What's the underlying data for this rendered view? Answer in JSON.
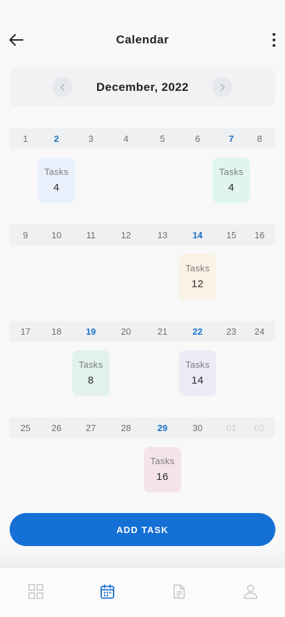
{
  "header": {
    "title": "Calendar",
    "back_icon": "arrow-left-icon",
    "more_icon": "more-vertical-icon"
  },
  "month_nav": {
    "label": "December, 2022",
    "prev_icon": "chevron-left-icon",
    "next_icon": "chevron-right-icon"
  },
  "weeks": [
    {
      "days": [
        {
          "label": "1",
          "state": "normal"
        },
        {
          "label": "2",
          "state": "highlight"
        },
        {
          "label": "3",
          "state": "normal"
        },
        {
          "label": "4",
          "state": "normal"
        },
        {
          "label": "5",
          "state": "normal"
        },
        {
          "label": "6",
          "state": "normal"
        },
        {
          "label": "7",
          "state": "highlight"
        },
        {
          "label": "8",
          "state": "normal"
        }
      ],
      "tasks": [
        {
          "day": "2",
          "label": "Tasks",
          "count": "4",
          "color": "#eaf1fd"
        },
        {
          "day": "7",
          "label": "Tasks",
          "count": "4",
          "color": "#e0f5ed"
        }
      ]
    },
    {
      "days": [
        {
          "label": "9",
          "state": "normal"
        },
        {
          "label": "10",
          "state": "normal"
        },
        {
          "label": "11",
          "state": "normal"
        },
        {
          "label": "12",
          "state": "normal"
        },
        {
          "label": "13",
          "state": "normal"
        },
        {
          "label": "14",
          "state": "highlight"
        },
        {
          "label": "15",
          "state": "normal"
        },
        {
          "label": "16",
          "state": "normal"
        }
      ],
      "tasks": [
        {
          "day": "14",
          "label": "Tasks",
          "count": "12",
          "color": "#fbf1e4"
        }
      ]
    },
    {
      "days": [
        {
          "label": "17",
          "state": "normal"
        },
        {
          "label": "18",
          "state": "normal"
        },
        {
          "label": "19",
          "state": "highlight"
        },
        {
          "label": "20",
          "state": "normal"
        },
        {
          "label": "21",
          "state": "normal"
        },
        {
          "label": "22",
          "state": "highlight"
        },
        {
          "label": "23",
          "state": "normal"
        },
        {
          "label": "24",
          "state": "normal"
        }
      ],
      "tasks": [
        {
          "day": "19",
          "label": "Tasks",
          "count": "8",
          "color": "#e0f2ea"
        },
        {
          "day": "22",
          "label": "Tasks",
          "count": "14",
          "color": "#ede9f7"
        }
      ]
    },
    {
      "days": [
        {
          "label": "25",
          "state": "normal"
        },
        {
          "label": "26",
          "state": "normal"
        },
        {
          "label": "27",
          "state": "normal"
        },
        {
          "label": "28",
          "state": "normal"
        },
        {
          "label": "29",
          "state": "highlight"
        },
        {
          "label": "30",
          "state": "normal"
        },
        {
          "label": "01",
          "state": "muted"
        },
        {
          "label": "02",
          "state": "muted"
        }
      ],
      "tasks": [
        {
          "day": "29",
          "label": "Tasks",
          "count": "16",
          "color": "#f4e4e9"
        }
      ]
    }
  ],
  "add_task": {
    "label": "ADD TASK"
  },
  "tabbar": {
    "tabs": [
      {
        "name": "tab-dashboard",
        "icon": "grid-icon",
        "active": false
      },
      {
        "name": "tab-calendar",
        "icon": "calendar-icon",
        "active": true
      },
      {
        "name": "tab-documents",
        "icon": "document-icon",
        "active": false
      },
      {
        "name": "tab-profile",
        "icon": "user-icon",
        "active": false
      }
    ]
  },
  "colors": {
    "accent": "#1570d6",
    "highlight_day": "#1a73c8",
    "inactive_icon": "#c4c4c4"
  }
}
